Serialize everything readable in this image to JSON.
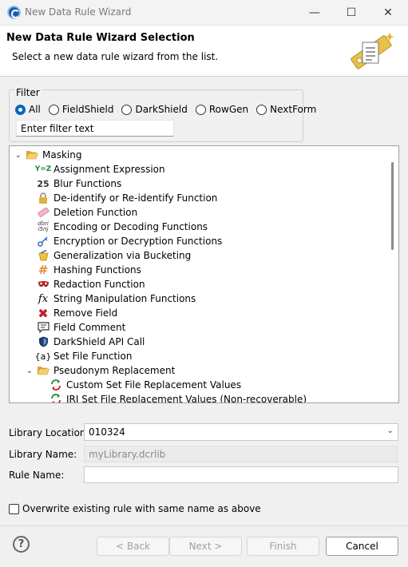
{
  "window": {
    "title": "New Data Rule Wizard",
    "min_glyph": "—",
    "max_glyph": "☐",
    "close_glyph": "✕"
  },
  "header": {
    "title": "New Data Rule Wizard Selection",
    "subtitle": "Select a new data rule wizard from the list."
  },
  "filter": {
    "legend": "Filter",
    "options": [
      "All",
      "FieldShield",
      "DarkShield",
      "RowGen",
      "NextForm"
    ],
    "selected": "All",
    "input_value": "Enter filter text"
  },
  "tree": {
    "items": [
      {
        "label": "Masking",
        "icon": "folder-open-icon",
        "level": 0,
        "expanded": true
      },
      {
        "label": "Assignment Expression",
        "icon": "assignment-icon",
        "level": 1
      },
      {
        "label": "Blur Functions",
        "icon": "blur-icon",
        "level": 1
      },
      {
        "label": "De-identify or Re-identify Function",
        "icon": "lock-icon",
        "level": 1
      },
      {
        "label": "Deletion Function",
        "icon": "eraser-icon",
        "level": 1
      },
      {
        "label": "Encoding or Decoding Functions",
        "icon": "encoding-icon",
        "level": 1
      },
      {
        "label": "Encryption or Decryption Functions",
        "icon": "key-icon",
        "level": 1
      },
      {
        "label": "Generalization via Bucketing",
        "icon": "bucket-icon",
        "level": 1
      },
      {
        "label": "Hashing Functions",
        "icon": "hash-icon",
        "level": 1
      },
      {
        "label": "Redaction Function",
        "icon": "mask-icon",
        "level": 1
      },
      {
        "label": "String Manipulation Functions",
        "icon": "function-icon",
        "level": 1
      },
      {
        "label": "Remove Field",
        "icon": "remove-icon",
        "level": 1
      },
      {
        "label": "Field Comment",
        "icon": "comment-icon",
        "level": 1
      },
      {
        "label": "DarkShield API Call",
        "icon": "darkshield-icon",
        "level": 1
      },
      {
        "label": "Set File Function",
        "icon": "set-file-icon",
        "level": 1
      },
      {
        "label": "Pseudonym Replacement",
        "icon": "folder-open-icon",
        "level": 1,
        "expanded": true
      },
      {
        "label": "Custom Set File Replacement Values",
        "icon": "replace-icon",
        "level": 2
      },
      {
        "label": "IRI Set File Replacement Values (Non-recoverable)",
        "icon": "replace-icon",
        "level": 2
      }
    ]
  },
  "form": {
    "library_location_label": "Library Location:",
    "library_location_value": "010324",
    "library_name_label": "Library Name:",
    "library_name_value": "myLibrary.dcrlib",
    "rule_name_label": "Rule Name:",
    "rule_name_value": "",
    "overwrite_label": "Overwrite existing rule with same name as above"
  },
  "buttons": {
    "help": "?",
    "back": "< Back",
    "next": "Next >",
    "finish": "Finish",
    "cancel": "Cancel"
  },
  "colors": {
    "accent": "#0067c0",
    "folder": "#e8b84a",
    "remove": "#c0202a"
  }
}
